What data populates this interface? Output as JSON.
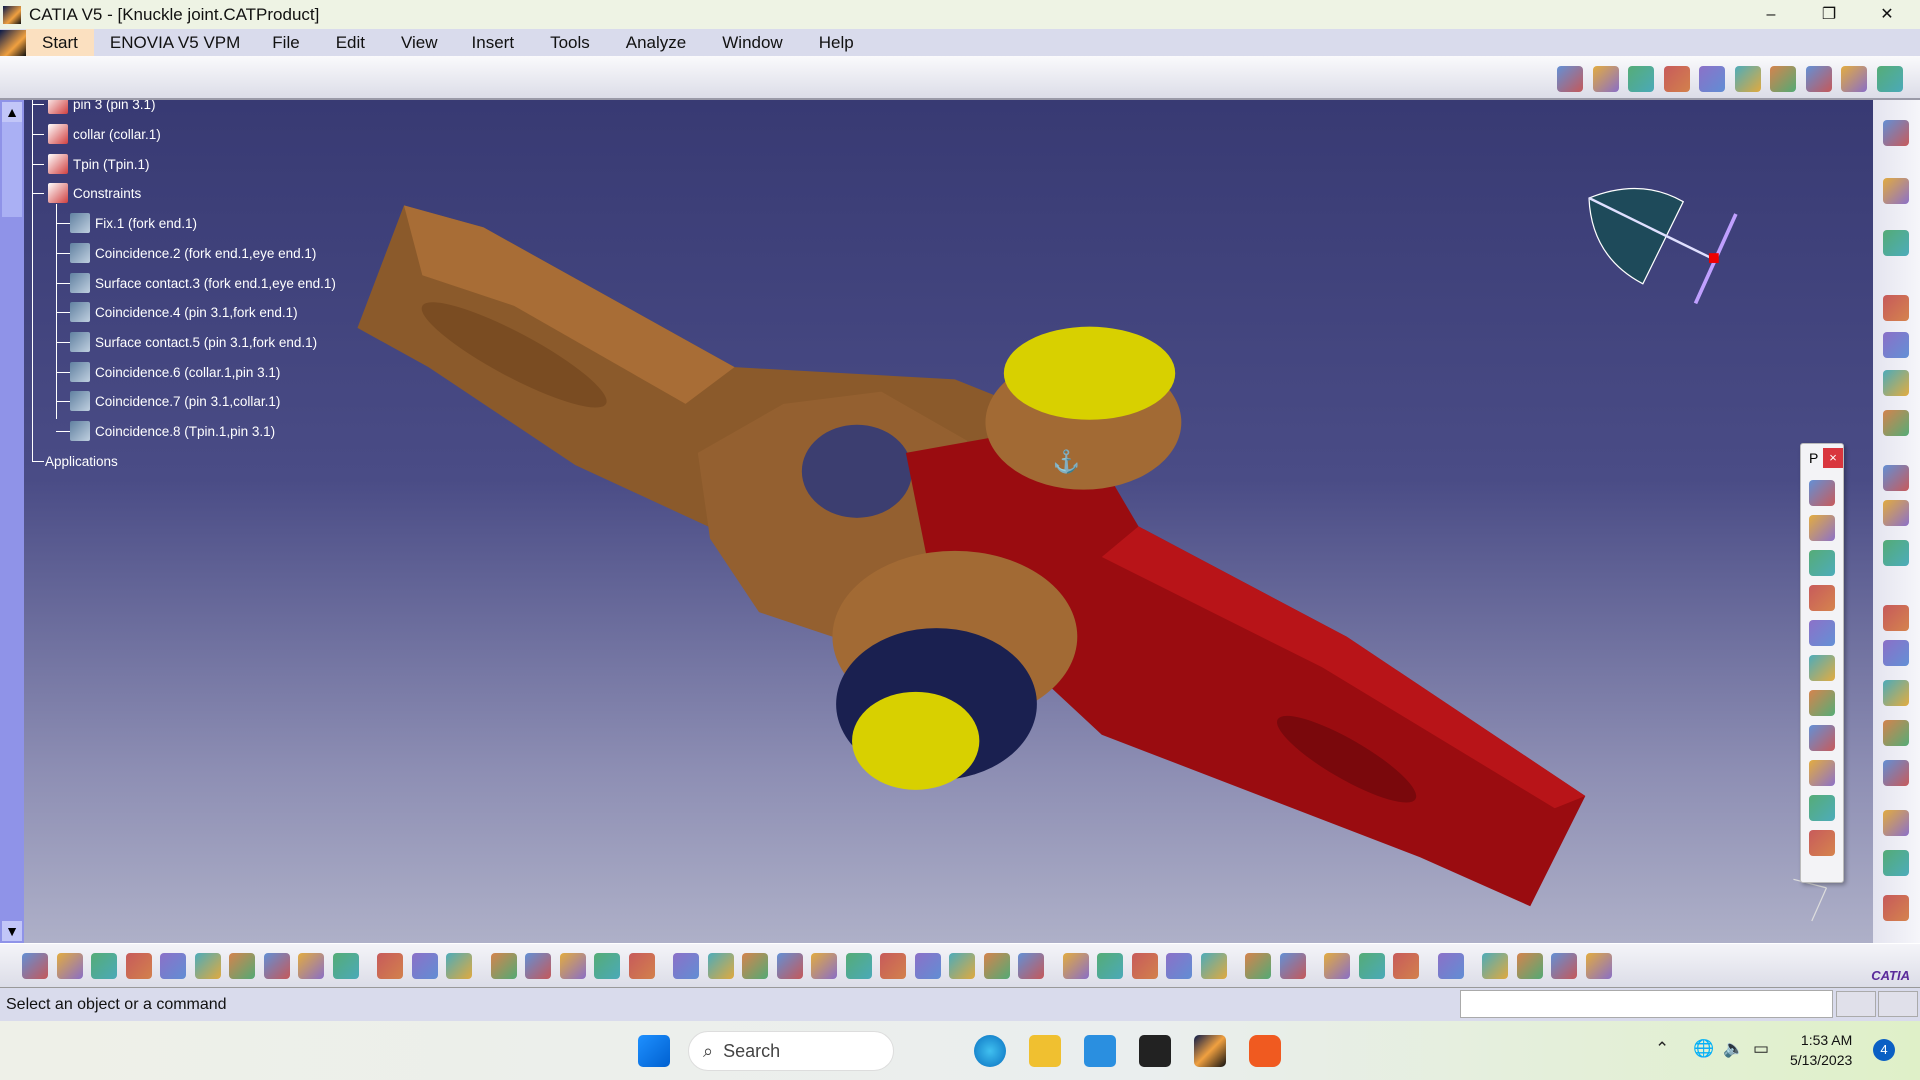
{
  "window": {
    "title": "CATIA V5 - [Knuckle joint.CATProduct]",
    "minimize": "–",
    "restore": "❐",
    "close": "✕"
  },
  "menu": {
    "items": [
      "Start",
      "ENOVIA V5 VPM",
      "File",
      "Edit",
      "View",
      "Insert",
      "Tools",
      "Analyze",
      "Window",
      "Help"
    ],
    "active": "Start"
  },
  "tree": {
    "nodes": [
      {
        "label": "pin 3 (pin 3.1)",
        "level": 1,
        "icon": "part-icon"
      },
      {
        "label": "collar (collar.1)",
        "level": 1,
        "icon": "part-icon"
      },
      {
        "label": "Tpin (Tpin.1)",
        "level": 1,
        "icon": "part-icon"
      },
      {
        "label": "Constraints",
        "level": 1,
        "icon": "constraints-icon"
      },
      {
        "label": "Fix.1 (fork end.1)",
        "level": 2,
        "icon": "fix-constraint-icon"
      },
      {
        "label": "Coincidence.2 (fork end.1,eye end.1)",
        "level": 2,
        "icon": "coincidence-icon"
      },
      {
        "label": "Surface contact.3 (fork end.1,eye end.1)",
        "level": 2,
        "icon": "surface-contact-icon"
      },
      {
        "label": "Coincidence.4 (pin 3.1,fork end.1)",
        "level": 2,
        "icon": "coincidence-icon"
      },
      {
        "label": "Surface contact.5 (pin 3.1,fork end.1)",
        "level": 2,
        "icon": "surface-contact-icon"
      },
      {
        "label": "Coincidence.6 (collar.1,pin 3.1)",
        "level": 2,
        "icon": "coincidence-icon"
      },
      {
        "label": "Coincidence.7 (pin 3.1,collar.1)",
        "level": 2,
        "icon": "coincidence-icon"
      },
      {
        "label": "Coincidence.8 (Tpin.1,pin 3.1)",
        "level": 2,
        "icon": "coincidence-icon"
      },
      {
        "label": "Applications",
        "level": 0,
        "icon": ""
      }
    ]
  },
  "scroll": {
    "up": "▲",
    "down": "▼"
  },
  "floating_toolbar": {
    "title": "P",
    "close": "×",
    "icons": [
      "manipulation-icon",
      "snap-icon",
      "smart-move-icon",
      "explode-icon",
      "clash-icon",
      "sectioning-icon",
      "distance-icon",
      "bom-icon",
      "scenes-icon",
      "catalog-icon",
      "constraint-analysis-icon"
    ]
  },
  "top_toolbar": {
    "icons": [
      "existing-component-icon",
      "new-product-icon",
      "new-part-icon",
      "replace-component-icon",
      "graph-tree-icon",
      "edit-icon",
      "measure-item-icon",
      "generate-numbering-icon",
      "update-icon",
      "fast-multi-instantiation-icon"
    ]
  },
  "right_toolbar": {
    "icons": [
      "product-icon",
      "select-icon",
      "manipulate-icon",
      "snap-icon",
      "explode-icon",
      "stop-manipulate-icon",
      "multi-instantiate-icon",
      "bill-of-material-icon",
      "design-mode-icon",
      "tree-reorder-icon",
      "coincidence-constraint-icon",
      "annotation-text-icon",
      "flag-note-icon",
      "weld-icon",
      "3d-annotation-icon",
      "view-icon",
      "capture-icon",
      "spec-tree-icon"
    ]
  },
  "bottom_toolbar": {
    "icons": [
      "new-icon",
      "open-icon",
      "save-icon",
      "print-icon",
      "cut-icon",
      "copy-icon",
      "paste-icon",
      "undo-icon",
      "redo-icon",
      "whats-this-icon",
      "formula-icon",
      "knowledge-icon",
      "catalog-icon",
      "table-icon",
      "graph-icon",
      "publication-icon",
      "bom-icon",
      "fly-mode-icon",
      "fit-all-icon",
      "pan-icon",
      "rotate-icon",
      "zoom-in-icon",
      "zoom-out-icon",
      "normal-view-icon",
      "multi-view-icon",
      "iso-view-icon",
      "shading-icon",
      "hide-show-icon",
      "swap-visible-icon",
      "update-icon",
      "expand-icon",
      "scene-icon",
      "scene-edit-icon",
      "capture-icon",
      "pointer-icon",
      "measure-between-icon",
      "measure-item-icon",
      "measure-inertia-icon",
      "rotate-cycle-icon",
      "sketch-plane-icon",
      "render-icon",
      "light-icon",
      "material-icon",
      "grid-icon"
    ]
  },
  "logo": "CATIA",
  "status": {
    "message": "Select an object or a command"
  },
  "taskbar": {
    "search_placeholder": "Search",
    "time": "1:53 AM",
    "date": "5/13/2023",
    "notifications": "4"
  },
  "colors": {
    "fork_end": "#8b5a2b",
    "eye_end": "#a00d10",
    "pin": "#d8d000",
    "collar": "#1a2050",
    "viewport_top": "#383a73"
  }
}
